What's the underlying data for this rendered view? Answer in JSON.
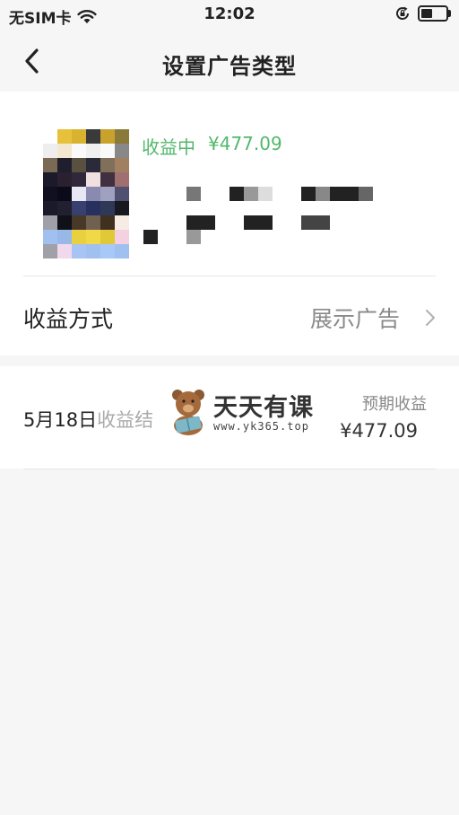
{
  "status_bar": {
    "carrier": "无SIM卡",
    "time": "12:02",
    "battery_level": 0.45
  },
  "nav": {
    "title": "设置广告类型"
  },
  "ad_card": {
    "income_status": "收益中",
    "income_amount": "¥477.09",
    "method_label": "收益方式",
    "method_value": "展示广告"
  },
  "earnings": {
    "date_prefix": "5月18日",
    "date_suffix": "收益结",
    "expected_label": "预期收益",
    "expected_value": "¥477.09"
  },
  "watermark": {
    "title": "天天有课",
    "url": "www.yk365.top"
  },
  "colors": {
    "accent_green": "#52b86b",
    "background": "#f6f6f6"
  }
}
